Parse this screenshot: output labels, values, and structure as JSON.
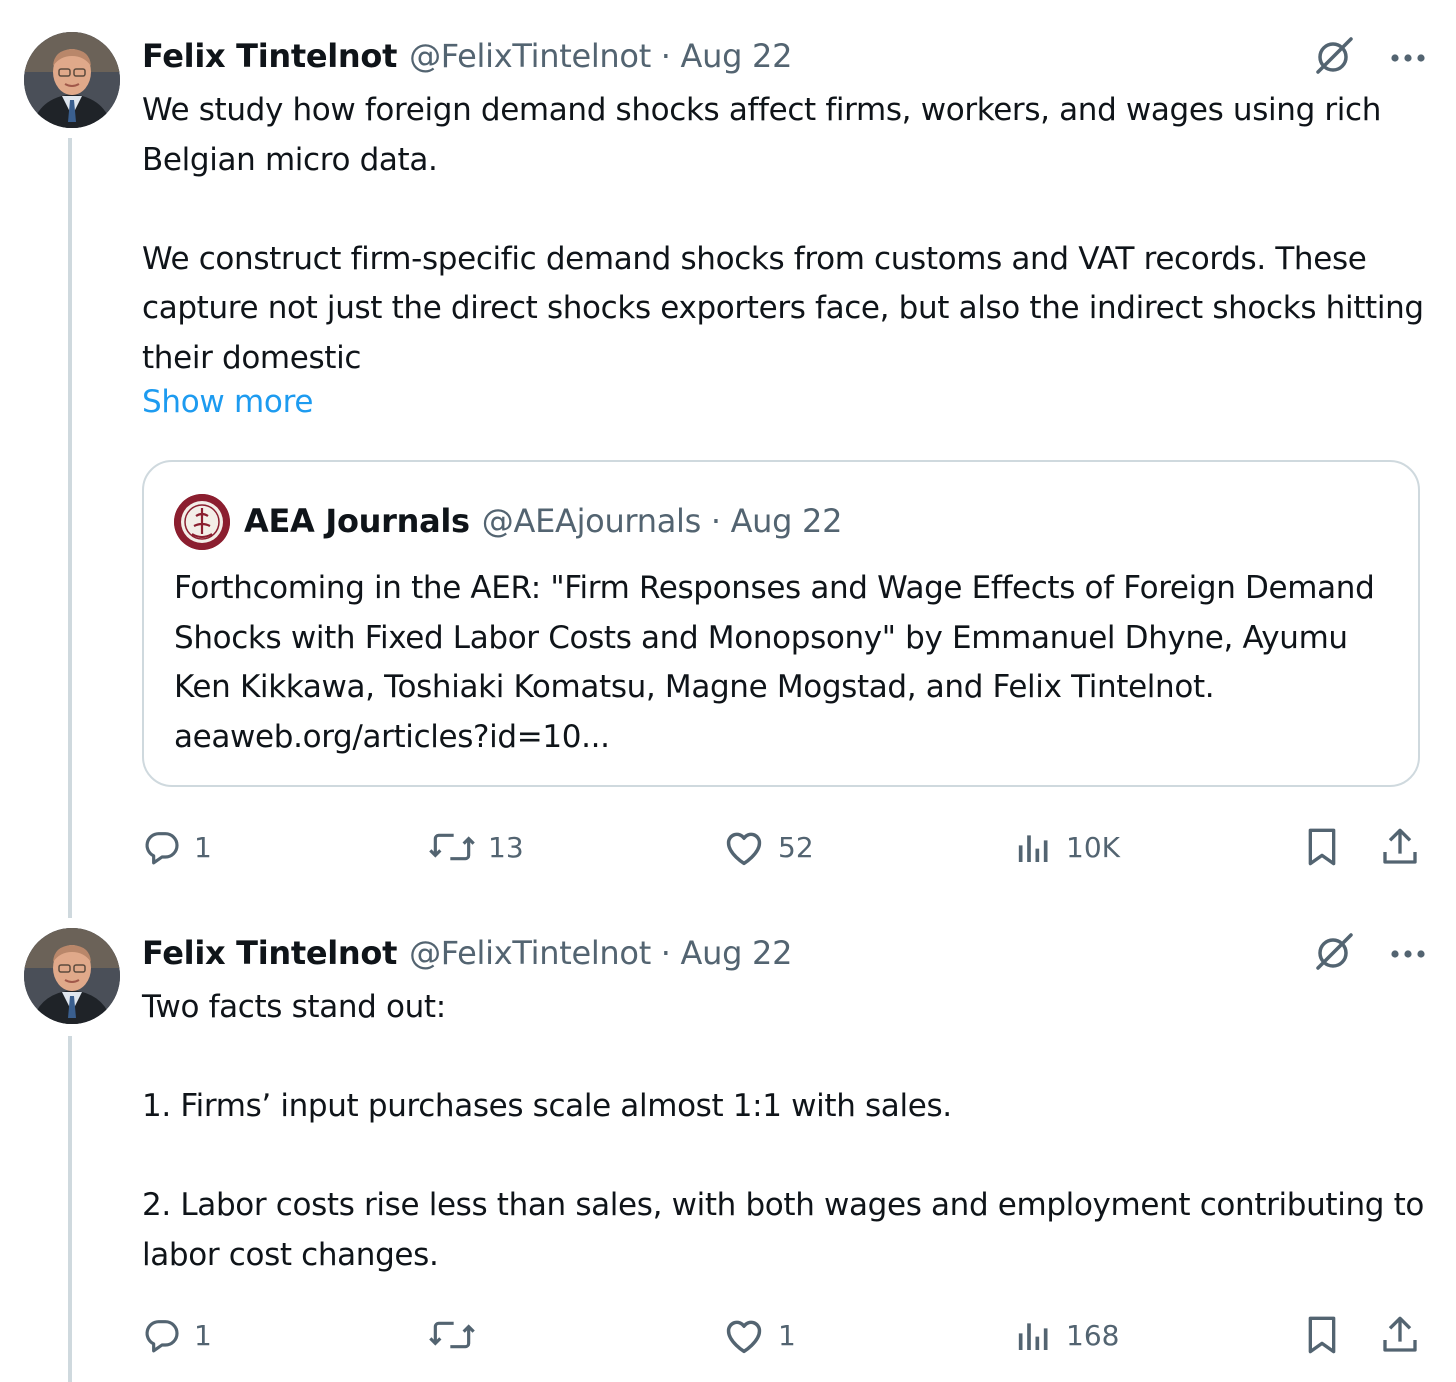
{
  "tweets": [
    {
      "author_name": "Felix Tintelnot",
      "meta": "@FelixTintelnot · Aug 22",
      "text": "We study how foreign demand shocks affect firms, workers, and wages using rich Belgian micro data.\n\nWe construct firm-specific demand shocks from customs and VAT records. These capture not just the direct shocks exporters face, but also the indirect shocks hitting their domestic",
      "show_more": "Show more",
      "quote": {
        "author_name": "AEA Journals",
        "meta": "@AEAjournals · Aug 22",
        "text": "Forthcoming in the AER: \"Firm Responses and Wage Effects of Foreign Demand Shocks with Fixed Labor Costs and Monopsony\" by Emmanuel Dhyne, Ayumu Ken Kikkawa, Toshiaki Komatsu, Magne Mogstad, and Felix Tintelnot. aeaweb.org/articles?id=10..."
      },
      "replies": "1",
      "reposts": "13",
      "likes": "52",
      "views": "10K"
    },
    {
      "author_name": "Felix Tintelnot",
      "meta": "@FelixTintelnot · Aug 22",
      "text": "Two facts stand out:\n\n1. Firms’ input purchases scale almost 1:1 with sales.\n\n2. Labor costs rise less than sales, with both wages and employment contributing to labor cost changes.",
      "replies": "1",
      "reposts": "",
      "likes": "1",
      "views": "168"
    }
  ],
  "colors": {
    "text": "#0f1419",
    "secondary": "#536471",
    "link": "#1d9bf0",
    "border": "#cfd9de"
  },
  "icons": [
    "grok-icon",
    "more-icon",
    "reply-icon",
    "repost-icon",
    "like-icon",
    "views-icon",
    "bookmark-icon",
    "share-icon"
  ]
}
